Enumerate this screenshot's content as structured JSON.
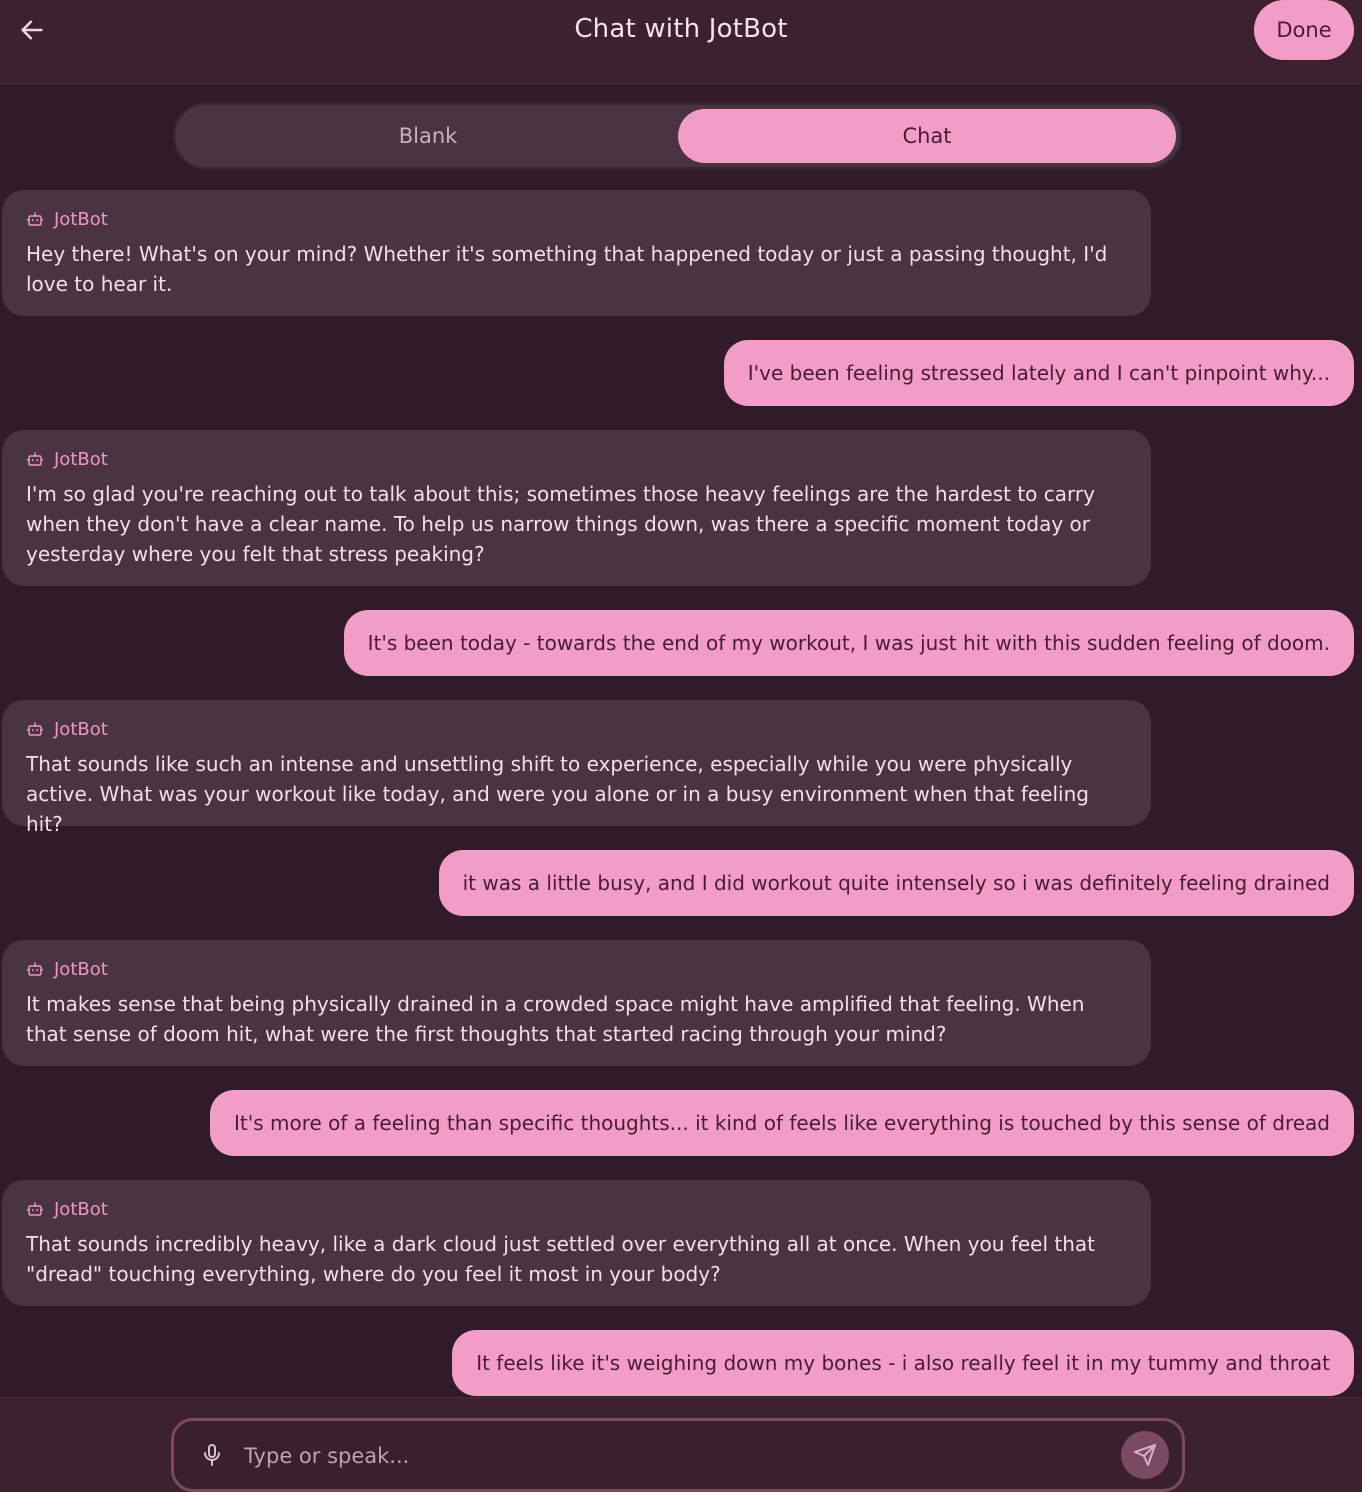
{
  "header": {
    "title": "Chat with JotBot",
    "done_label": "Done",
    "back_icon": "arrow-left-icon"
  },
  "mode_toggle": {
    "options": [
      "Blank",
      "Chat"
    ],
    "selected": "Chat"
  },
  "messages": [
    {
      "role": "bot",
      "name": "JotBot",
      "text": "Hey there! What's on your mind? Whether it's something that happened today or just a passing thought, I'd love to hear it."
    },
    {
      "role": "user",
      "text": "I've been feeling stressed lately and I can't pinpoint why..."
    },
    {
      "role": "bot",
      "name": "JotBot",
      "text": "I'm so glad you're reaching out to talk about this; sometimes those heavy feelings are the hardest to carry when they don't have a clear name. To help us narrow things down, was there a specific moment today or yesterday where you felt that stress peaking?"
    },
    {
      "role": "user",
      "text": "It's been today - towards the end of my workout, I was just hit with this sudden feeling of doom."
    },
    {
      "role": "bot",
      "name": "JotBot",
      "text": "That sounds like such an intense and unsettling shift to experience, especially while you were physically active. What was your workout like today, and were you alone or in a busy environment when that feeling hit?"
    },
    {
      "role": "user",
      "text": "it was a little busy, and I did workout quite intensely so i was definitely feeling drained"
    },
    {
      "role": "bot",
      "name": "JotBot",
      "text": "It makes sense that being physically drained in a crowded space might have amplified that feeling. When that sense of doom hit, what were the first thoughts that started racing through your mind?"
    },
    {
      "role": "user",
      "text": "It's more of a feeling than specific thoughts... it kind of feels like everything is touched by this sense of dread"
    },
    {
      "role": "bot",
      "name": "JotBot",
      "text": "That sounds incredibly heavy, like a dark cloud just settled over everything all at once. When you feel that \"dread\" touching everything, where do you feel it most in your body?"
    },
    {
      "role": "user",
      "text": "It feels like it's weighing down my bones - i also really feel it in my tummy and throat"
    }
  ],
  "composer": {
    "placeholder": "Type or speak...",
    "value": "",
    "mic_icon": "microphone-icon",
    "send_icon": "send-icon"
  },
  "colors": {
    "background": "#321b29",
    "header": "#3e212f",
    "bot_bubble": "#4a3442",
    "user_bubble": "#f19dc8",
    "accent": "#ef95c6"
  }
}
